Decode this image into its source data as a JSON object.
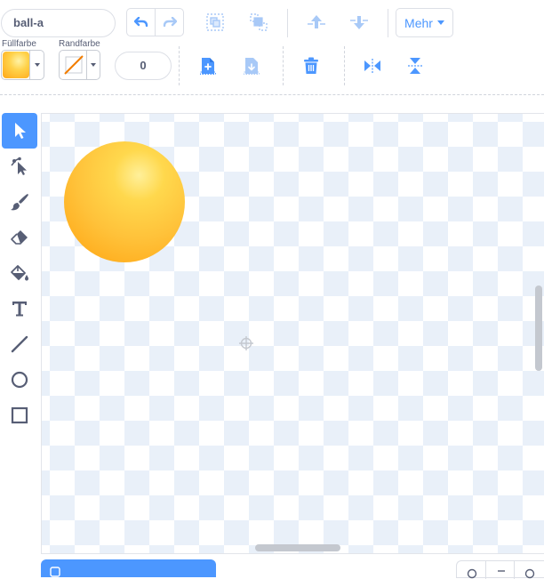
{
  "costume": {
    "name": "ball-a"
  },
  "toolbar": {
    "more_label": "Mehr",
    "fill_label": "Füllfarbe",
    "outline_label": "Randfarbe",
    "outline_width": "0"
  },
  "colors": {
    "accent": "#4c97ff",
    "fill_swatch": "#ffc23a",
    "outline_slash": "#f27d00",
    "checker": "#e9f0f9"
  },
  "tools": [
    {
      "name": "select-tool",
      "icon": "arrow-cursor-icon"
    },
    {
      "name": "reshape-tool",
      "icon": "reshape-icon"
    },
    {
      "name": "brush-tool",
      "icon": "brush-icon"
    },
    {
      "name": "eraser-tool",
      "icon": "eraser-icon"
    },
    {
      "name": "fill-tool",
      "icon": "paint-bucket-icon"
    },
    {
      "name": "text-tool",
      "icon": "text-icon"
    },
    {
      "name": "line-tool",
      "icon": "line-icon"
    },
    {
      "name": "circle-tool",
      "icon": "circle-icon"
    },
    {
      "name": "rectangle-tool",
      "icon": "rectangle-icon"
    }
  ]
}
